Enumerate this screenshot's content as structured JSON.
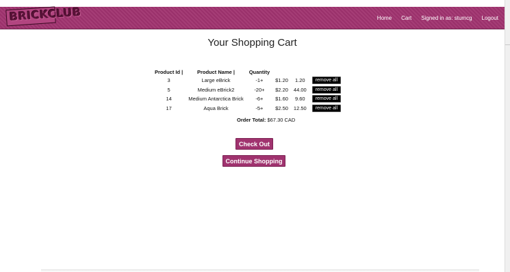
{
  "nav": {
    "logo_text": "BRICKCLUB",
    "home": "Home",
    "cart": "Cart",
    "signed_in": "Signed in as: stumcg",
    "logout": "Logout"
  },
  "page_title": "Your Shopping Cart",
  "table": {
    "headers": [
      "Product Id |",
      "Product Name |",
      "Quantity",
      "",
      "",
      ""
    ],
    "rows": [
      {
        "id": "3",
        "name": "Large eBrick",
        "qty": "-1+",
        "price": "$1.20",
        "total": "1.20",
        "action": "remove all"
      },
      {
        "id": "5",
        "name": "Medium eBrick2",
        "qty": "-20+",
        "price": "$2.20",
        "total": "44.00",
        "action": "remove all"
      },
      {
        "id": "14",
        "name": "Medium Antarctica Brick",
        "qty": "-6+",
        "price": "$1.60",
        "total": "9.60",
        "action": "remove all"
      },
      {
        "id": "17",
        "name": "Aqua Brick",
        "qty": "-5+",
        "price": "$2.50",
        "total": "12.50",
        "action": "remove all"
      }
    ]
  },
  "order_total": {
    "label": "Order Total:",
    "value": "$67.30 CAD"
  },
  "buttons": {
    "checkout": "Check Out",
    "continue": "Continue Shopping"
  },
  "colors": {
    "brand": "#a0336f",
    "button_dark": "#000000"
  }
}
